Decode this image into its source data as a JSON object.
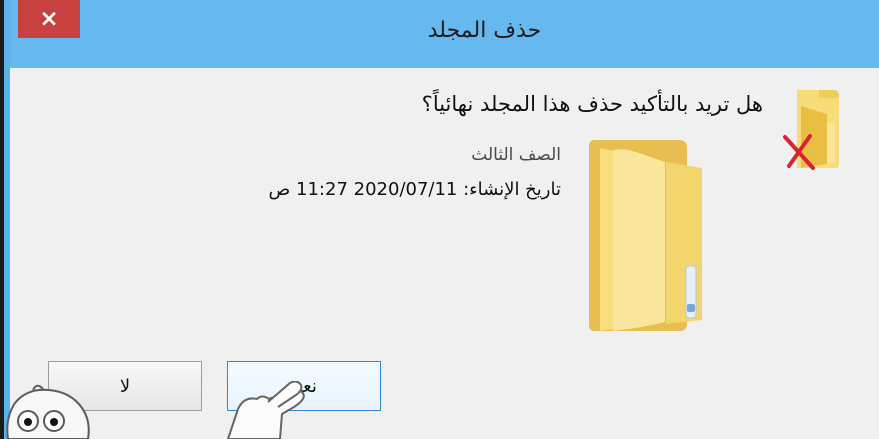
{
  "dialog": {
    "title": "حذف المجلد",
    "close_label": "×",
    "question": "هل تريد بالتأكيد حذف هذا المجلد نهائياً؟",
    "folder_name": "الصف الثالث",
    "created_label": "تاريخ الإنشاء: 2020/07/11 11:27 ص"
  },
  "buttons": {
    "yes_label": "نعم",
    "no_label": "لا"
  },
  "icons": {
    "small_folder": "folder-delete-icon",
    "big_folder": "folder-icon",
    "mascot": "robot-mascot-icon",
    "hand": "pointer-hand-icon"
  },
  "colors": {
    "title_bar": "#65b9ef",
    "close_button": "#c74141",
    "folder_yellow": "#f5d76e"
  }
}
